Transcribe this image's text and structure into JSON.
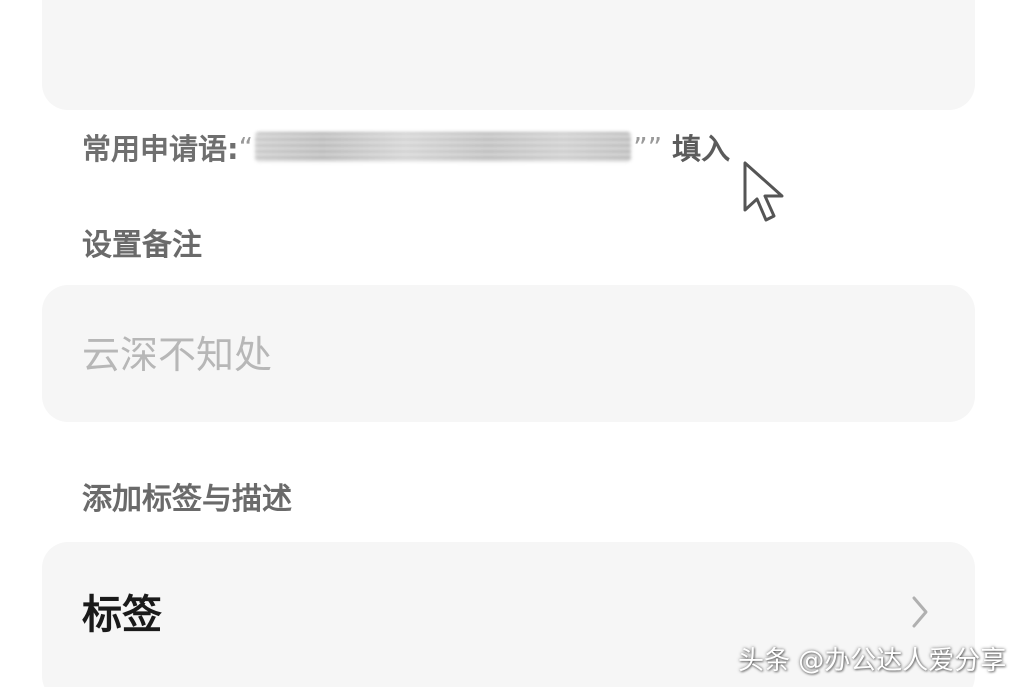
{
  "greeting": {
    "label": "常用申请语:",
    "open_quote": "“",
    "close_quote": "””",
    "fill_label": "填入"
  },
  "remark": {
    "title": "设置备注",
    "placeholder": "云深不知处"
  },
  "tags_section": {
    "title": "添加标签与描述",
    "tags_label": "标签"
  },
  "watermark": "头条 @办公达人爱分享",
  "icons": {
    "cursor": "mouse-pointer-icon",
    "chevron": "chevron-right-icon"
  },
  "colors": {
    "card_background": "#f6f6f6",
    "section_title": "#6a6a6a",
    "placeholder": "#b7b7b7",
    "primary_text": "#1a1a1a"
  }
}
